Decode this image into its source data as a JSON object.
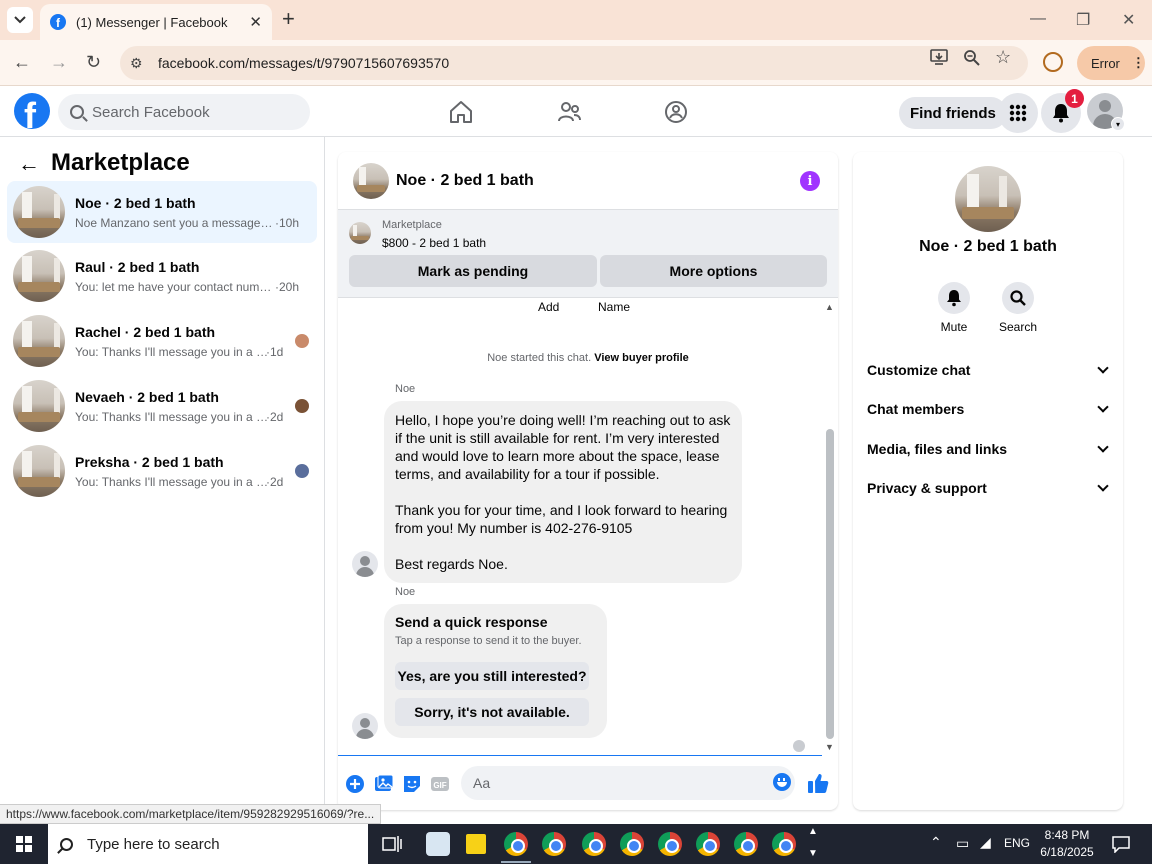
{
  "browser": {
    "tab_title": "(1) Messenger | Facebook",
    "url": "facebook.com/messages/t/9790715607693570",
    "profile_status": "Error",
    "status_url": "https://www.facebook.com/marketplace/item/959282929516069/?re..."
  },
  "fb": {
    "search_placeholder": "Search Facebook",
    "find_friends": "Find friends",
    "notification_count": "1",
    "brand_color": "#1877f2"
  },
  "left_panel": {
    "title": "Marketplace",
    "conversations": [
      {
        "title": "Noe · 2 bed 1 bath",
        "snippet": "Noe Manzano sent you a message a...",
        "time": "·10h",
        "active": true
      },
      {
        "title": "Raul · 2 bed 1 bath",
        "snippet": "You: let me have your contact numb...",
        "time": "·20h",
        "active": false
      },
      {
        "title": "Rachel · 2 bed 1 bath",
        "snippet": "You: Thanks I'll message you in a m...",
        "time": "·1d",
        "active": false
      },
      {
        "title": "Nevaeh · 2 bed 1 bath",
        "snippet": "You: Thanks I'll message you in a m...",
        "time": "·2d",
        "active": false
      },
      {
        "title": "Preksha · 2 bed 1 bath",
        "snippet": "You: Thanks I'll message you in a m...",
        "time": "·2d",
        "active": false
      }
    ]
  },
  "chat": {
    "title": "Noe · 2 bed 1 bath",
    "marketplace_label": "Marketplace",
    "listing": "$800 - 2 bed 1 bath",
    "mark_pending": "Mark as pending",
    "more_options": "More options",
    "col_add": "Add",
    "col_name": "Name",
    "system_note": "Noe started this chat.",
    "view_profile": "View buyer profile",
    "sender": "Noe",
    "message_lines": [
      "Hello, I hope you’re doing well! I’m reaching out to ask",
      "if the unit is still available for rent. I’m very interested",
      "and would love to learn more about the space, lease",
      "terms, and availability for a tour if possible.",
      "",
      "Thank you for your time, and I look forward to hearing",
      "from you! My number is 402-276-9105",
      "",
      "Best regards Noe."
    ],
    "quick_response_title": "Send a quick response",
    "quick_response_sub": "Tap a response to send it to the buyer.",
    "quick_1": "Yes, are you still interested?",
    "quick_2": "Sorry, it's not available.",
    "input_placeholder": "Aa"
  },
  "right_panel": {
    "title": "Noe · 2 bed 1 bath",
    "mute": "Mute",
    "search": "Search",
    "sections": [
      "Customize chat",
      "Chat members",
      "Media, files and links",
      "Privacy & support"
    ]
  },
  "taskbar": {
    "search_text": "Type here to search",
    "language": "ENG",
    "time": "8:48 PM",
    "date": "6/18/2025"
  }
}
